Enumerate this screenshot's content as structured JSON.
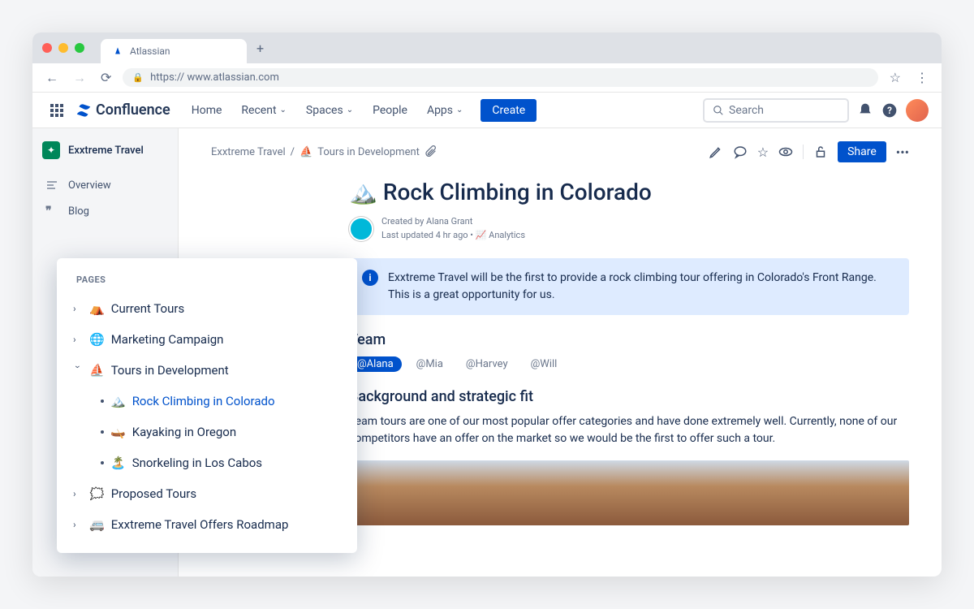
{
  "browser": {
    "tab_title": "Atlassian",
    "url": "https:// www.atlassian.com"
  },
  "header": {
    "product_name": "Confluence",
    "nav": {
      "home": "Home",
      "recent": "Recent",
      "spaces": "Spaces",
      "people": "People",
      "apps": "Apps"
    },
    "create_label": "Create",
    "search_placeholder": "Search"
  },
  "sidebar": {
    "space_name": "Exxtreme Travel",
    "overview": "Overview",
    "blog": "Blog"
  },
  "pages_tree": {
    "heading": "PAGES",
    "items": [
      {
        "icon": "⛺",
        "label": "Current Tours"
      },
      {
        "icon": "🌐",
        "label": "Marketing Campaign"
      },
      {
        "icon": "⛵",
        "label": "Tours in Development",
        "expanded": true
      },
      {
        "icon": "🗯️",
        "label": "Proposed Tours"
      },
      {
        "icon": "🚐",
        "label": "Exxtreme Travel Offers Roadmap"
      }
    ],
    "children": [
      {
        "icon": "🏔️",
        "label": "Rock Climbing in Colorado",
        "active": true
      },
      {
        "icon": "🛶",
        "label": "Kayaking in Oregon"
      },
      {
        "icon": "🏝️",
        "label": "Snorkeling in Los Cabos"
      }
    ]
  },
  "breadcrumb": {
    "space": "Exxtreme Travel",
    "parent_icon": "⛵",
    "parent": "Tours in Development"
  },
  "page_actions": {
    "share_label": "Share"
  },
  "page": {
    "title_icon": "🏔️",
    "title": "Rock Climbing in Colorado",
    "created_by": "Created by Alana Grant",
    "updated": "Last updated 4 hr ago",
    "analytics": "Analytics",
    "info_panel": "Exxtreme Travel will be the first to provide a rock climbing tour offering in Colorado's Front Range. This is a great opportunity for us.",
    "team_heading": "Team",
    "mentions": [
      "@Alana",
      "@Mia",
      "@Harvey",
      "@Will"
    ],
    "background_heading": "Background and strategic fit",
    "background_text": "Team tours are one of our most popular offer categories and have done extremely well. Currently, none of our competitors have an offer on the market so we would be the first to offer such a tour."
  }
}
